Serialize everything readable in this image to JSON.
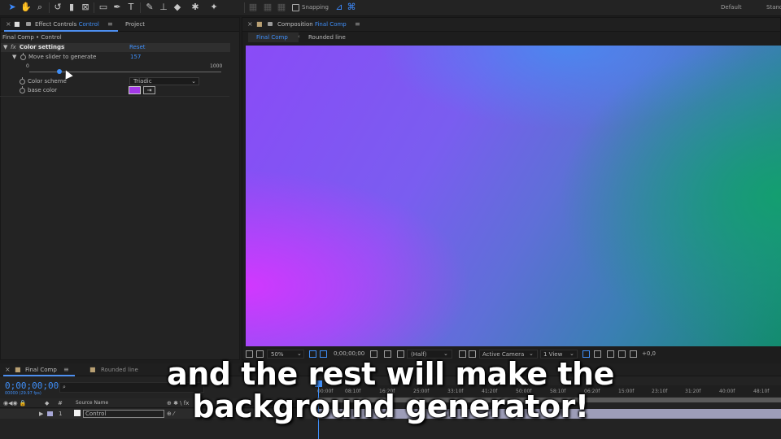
{
  "toolbar": {
    "snapping_label": "Snapping",
    "workspace_default": "Default",
    "workspace_standard": "Stand"
  },
  "effect_controls": {
    "tab_prefix": "Effect Controls",
    "tab_layer": "Control",
    "project_tab": "Project",
    "breadcrumb": "Final Comp • Control",
    "effect_name": "Color settings",
    "reset_label": "Reset",
    "slider_label": "Move slider to generate",
    "slider_value": "157",
    "slider_min": "0",
    "slider_max": "1000",
    "slider_fraction": 0.157,
    "color_scheme_label": "Color scheme",
    "color_scheme_value": "Triadic",
    "base_color_label": "base color",
    "base_color_hex": "#a238e6"
  },
  "composition": {
    "tab_prefix": "Composition",
    "tab_comp": "Final Comp",
    "subtab_active": "Final Comp",
    "subtab_other": "Rounded line",
    "zoom": "50%",
    "timecode": "0;00;00;00",
    "resolution": "(Half)",
    "camera": "Active Camera",
    "view": "1 View",
    "exposure": "+0,0"
  },
  "timeline": {
    "tab_active": "Final Comp",
    "tab_other": "Rounded line",
    "current_time": "0;00;00;00",
    "fps": "00000 (29.97 fps)",
    "col_hash": "#",
    "col_source": "Source Name",
    "layer_index": "1",
    "layer_name": "Control",
    "ticks": [
      "00:00f",
      "08:10f",
      "16:20f",
      "25:00f",
      "33:10f",
      "41:20f",
      "50:00f",
      "58:10f",
      "06:20f",
      "15:00f",
      "23:10f",
      "31:20f",
      "40:00f",
      "48:10f"
    ]
  },
  "caption": {
    "line1": "and the rest will make the",
    "line2": "background generator!"
  }
}
